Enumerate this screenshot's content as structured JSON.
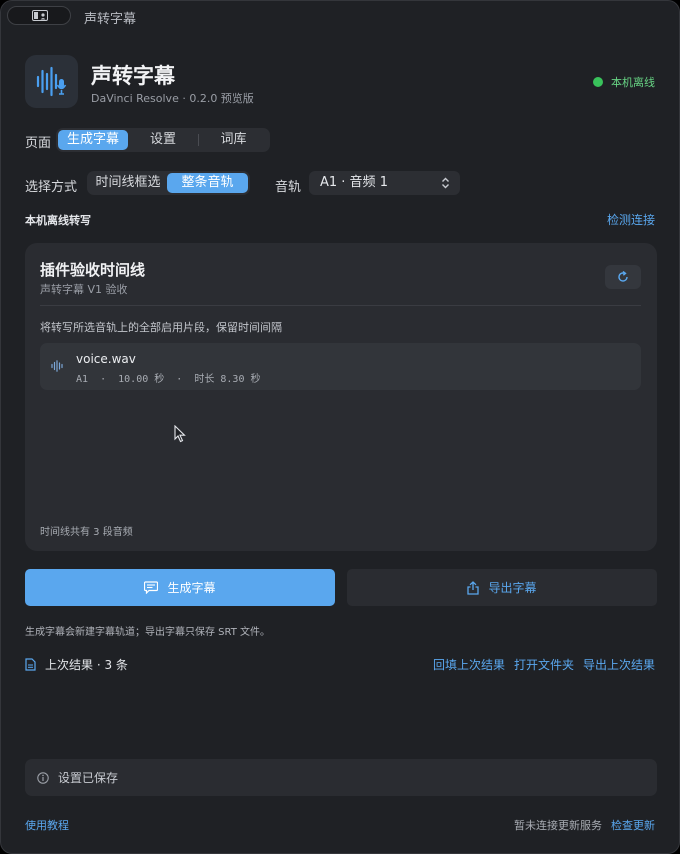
{
  "window": {
    "title": "声转字幕"
  },
  "app": {
    "name": "声转字幕",
    "subtitle": "DaVinci Resolve · 0.2.0 预览版",
    "icon": "waveform-mic-icon"
  },
  "status": {
    "label": "本机离线",
    "color": "#39c25b"
  },
  "page_nav": {
    "label": "页面",
    "tabs": [
      {
        "label": "生成字幕",
        "active": true
      },
      {
        "label": "设置",
        "active": false
      },
      {
        "label": "词库",
        "active": false
      }
    ]
  },
  "selection": {
    "label": "选择方式",
    "modes": [
      {
        "label": "时间线框选",
        "active": false
      },
      {
        "label": "整条音轨",
        "active": true
      }
    ],
    "track_label": "音轨",
    "track_value": "A1 · 音频 1"
  },
  "section": {
    "title": "本机离线转写",
    "detect_link": "检测连接"
  },
  "card": {
    "title": "插件验收时间线",
    "subtitle": "声转字幕 V1 验收",
    "description": "将转写所选音轨上的全部启用片段，保留时间间隔",
    "files": [
      {
        "name": "voice.wav",
        "meta": "A1  ·  10.00 秒  ·  时长 8.30 秒"
      }
    ],
    "footer": "时间线共有 3 段音频"
  },
  "actions": {
    "generate": "生成字幕",
    "export": "导出字幕",
    "note": "生成字幕会新建字幕轨道；导出字幕只保存 SRT 文件。"
  },
  "last_result": {
    "label": "上次结果 · 3 条",
    "links": [
      "回填上次结果",
      "打开文件夹",
      "导出上次结果"
    ]
  },
  "toast": {
    "text": "设置已保存"
  },
  "footer": {
    "tutorial": "使用教程",
    "update_status": "暂未连接更新服务",
    "check_update": "检查更新"
  },
  "colors": {
    "accent": "#5aa7ee",
    "background": "#1f2125",
    "card": "#2a2c31",
    "success": "#39c25b"
  }
}
